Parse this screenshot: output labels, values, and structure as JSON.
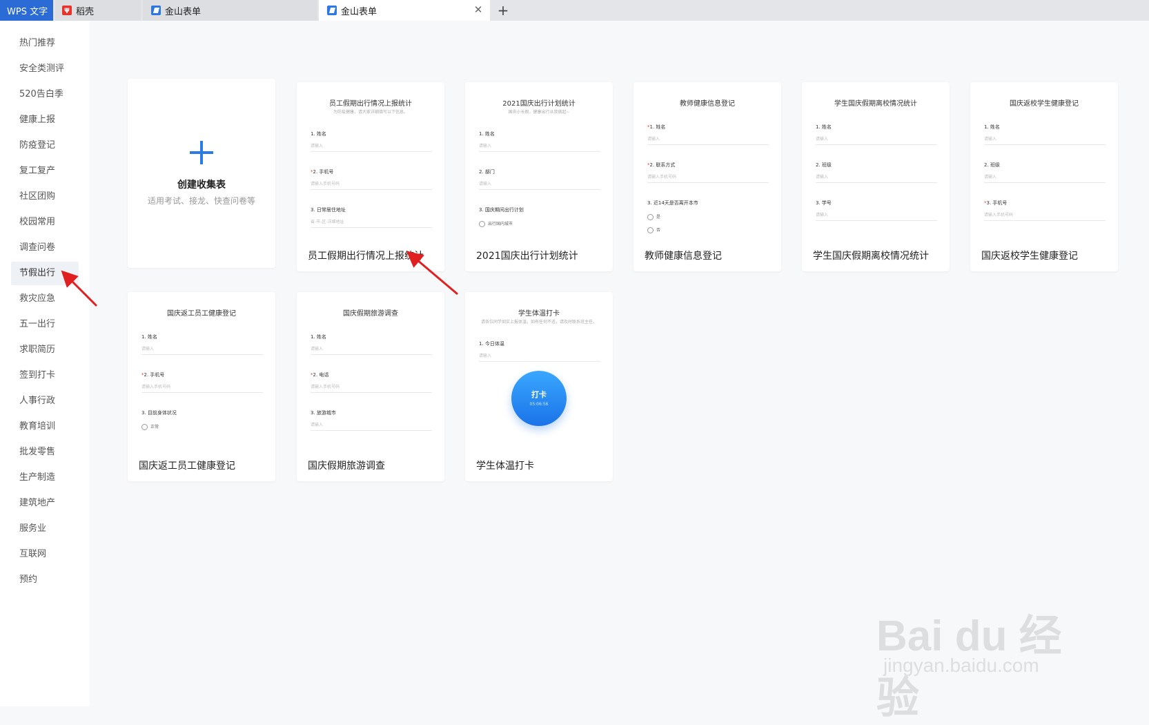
{
  "tabs": [
    {
      "label": "WPS 文字"
    },
    {
      "label": "稻壳"
    },
    {
      "label": "金山表单"
    },
    {
      "label": "金山表单"
    }
  ],
  "sidebar": {
    "items": [
      {
        "label": "热门推荐"
      },
      {
        "label": "安全类测评"
      },
      {
        "label": "520告白季"
      },
      {
        "label": "健康上报"
      },
      {
        "label": "防疫登记"
      },
      {
        "label": "复工复产"
      },
      {
        "label": "社区团购"
      },
      {
        "label": "校园常用"
      },
      {
        "label": "调查问卷"
      },
      {
        "label": "节假出行"
      },
      {
        "label": "救灾应急"
      },
      {
        "label": "五一出行"
      },
      {
        "label": "求职简历"
      },
      {
        "label": "签到打卡"
      },
      {
        "label": "人事行政"
      },
      {
        "label": "教育培训"
      },
      {
        "label": "批发零售"
      },
      {
        "label": "生产制造"
      },
      {
        "label": "建筑地产"
      },
      {
        "label": "服务业"
      },
      {
        "label": "互联网"
      },
      {
        "label": "预约"
      }
    ],
    "active": "节假出行"
  },
  "create": {
    "title": "创建收集表",
    "subtitle": "适用考试、接龙、快查问卷等"
  },
  "cards": [
    {
      "name": "员工假期出行情况上报统计",
      "preview_title": "员工假期出行情况上报统计",
      "preview_sub": "为防疫健康，请大家详细填写以下信息。",
      "fields": [
        {
          "label": "1. 姓名",
          "input": "请输入"
        },
        {
          "label": "2. 手机号",
          "input": "请输入手机号码"
        },
        {
          "label": "3. 日常居住地址",
          "input": "省-市-区-详细地址"
        }
      ]
    },
    {
      "name": "2021国庆出行计划统计",
      "preview_title": "2021国庆出行计划统计",
      "preview_sub": "国庆小长假，健康出行从我做起~",
      "fields": [
        {
          "label": "1. 姓名",
          "input": "请输入"
        },
        {
          "label": "2. 部门",
          "input": "请输入"
        },
        {
          "label": "3. 国庆期间出行计划",
          "option": "出行国内城市"
        }
      ]
    },
    {
      "name": "教师健康信息登记",
      "preview_title": "教师健康信息登记",
      "fields": [
        {
          "label": "1. 姓名",
          "input": "请输入"
        },
        {
          "label": "2. 联系方式",
          "input": "请输入手机号码"
        },
        {
          "label": "3. 近14天是否离开本市",
          "options": [
            "是",
            "否"
          ]
        }
      ]
    },
    {
      "name": "学生国庆假期离校情况统计",
      "preview_title": "学生国庆假期离校情况统计",
      "fields": [
        {
          "label": "1. 姓名",
          "input": "请输入"
        },
        {
          "label": "2. 班级",
          "input": "请输入"
        },
        {
          "label": "3. 学号",
          "input": "请输入"
        }
      ]
    },
    {
      "name": "国庆返校学生健康登记",
      "preview_title": "国庆返校学生健康登记",
      "fields": [
        {
          "label": "1. 姓名",
          "input": "请输入"
        },
        {
          "label": "2. 班级",
          "input": "请输入"
        },
        {
          "label": "3. 手机号",
          "input": "请输入手机号码"
        }
      ]
    },
    {
      "name": "国庆返工员工健康登记",
      "preview_title": "国庆返工员工健康登记",
      "fields": [
        {
          "label": "1. 姓名",
          "input": "请输入"
        },
        {
          "label": "2. 手机号",
          "input": "请输入手机号码"
        },
        {
          "label": "3. 目前身体状况",
          "option": "正常"
        }
      ]
    },
    {
      "name": "国庆假期旅游调查",
      "preview_title": "国庆假期旅游调查",
      "fields": [
        {
          "label": "1. 姓名",
          "input": "请输入"
        },
        {
          "label": "2. 电话",
          "input": "请输入手机号码"
        },
        {
          "label": "3. 旅游城市",
          "input": "请输入"
        }
      ]
    },
    {
      "name": "学生体温打卡",
      "preview_title": "学生体温打卡",
      "preview_sub": "请各位同学如实上报体温，如有任何不适，请及时联系班主任。",
      "fields": [
        {
          "label": "1. 今日体温",
          "input": "请输入"
        }
      ],
      "punch": {
        "label": "打卡",
        "time": "05:06:56"
      }
    }
  ],
  "watermark": {
    "text": "Bai du 经验",
    "url": "jingyan.baidu.com"
  }
}
